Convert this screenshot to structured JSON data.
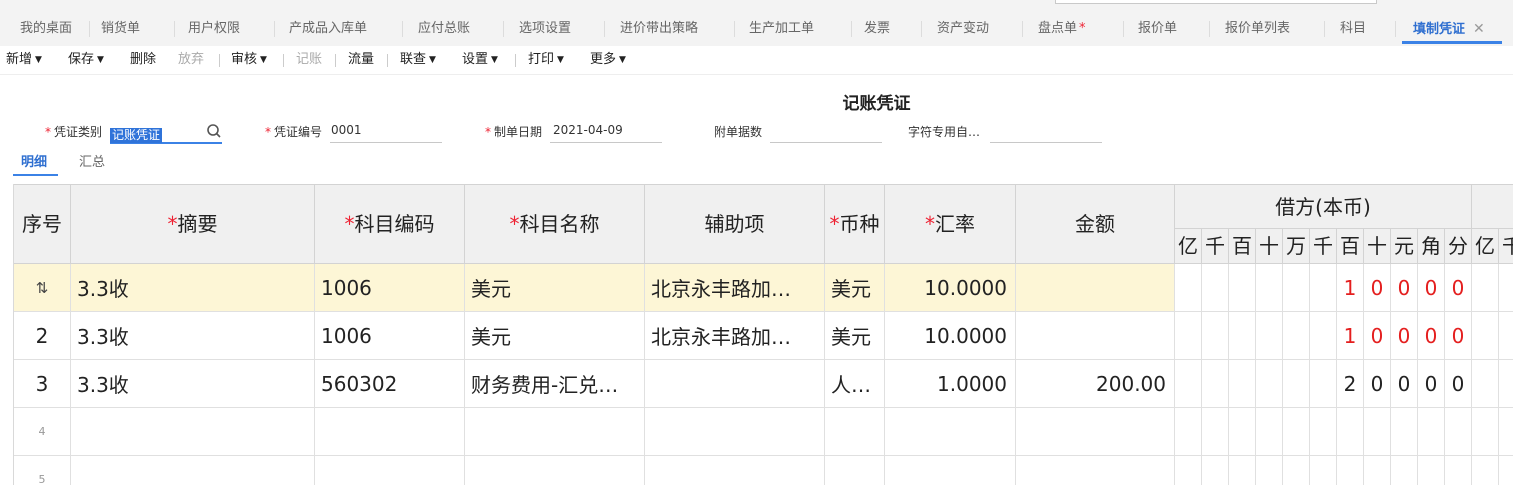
{
  "tabs": [
    {
      "label": "我的桌面"
    },
    {
      "label": "销货单"
    },
    {
      "label": "用户权限"
    },
    {
      "label": "产成品入库单"
    },
    {
      "label": "应付总账"
    },
    {
      "label": "选项设置"
    },
    {
      "label": "进价带出策略"
    },
    {
      "label": "生产加工单"
    },
    {
      "label": "发票"
    },
    {
      "label": "资产变动"
    },
    {
      "label": "盘点单",
      "star": "*"
    },
    {
      "label": "报价单"
    },
    {
      "label": "报价单列表"
    },
    {
      "label": "科目"
    },
    {
      "label": "填制凭证",
      "close": "✕"
    }
  ],
  "toolbar": {
    "add": "新增",
    "save": "保存",
    "delete": "删除",
    "discard": "放弃",
    "audit": "审核",
    "post": "记账",
    "flow": "流量",
    "lookup": "联查",
    "settings": "设置",
    "print": "打印",
    "more": "更多"
  },
  "voucher": {
    "title": "记账凭证",
    "type_label": "凭证类别",
    "type_value": "记账凭证",
    "no_label": "凭证编号",
    "no_value": "0001",
    "date_label": "制单日期",
    "date_value": "2021-04-09",
    "attach_label": "附单据数",
    "custom_label": "字符专用自…"
  },
  "subtabs": {
    "detail": "明细",
    "summary": "汇总"
  },
  "table": {
    "headers": {
      "seq": "序号",
      "summary": "摘要",
      "code": "科目编码",
      "name": "科目名称",
      "aux": "辅助项",
      "currency": "币种",
      "rate": "汇率",
      "amount": "金额",
      "debit": "借方(本币)"
    },
    "req_mark": "*",
    "digits": [
      "亿",
      "千",
      "百",
      "十",
      "万",
      "千",
      "百",
      "十",
      "元",
      "角",
      "分"
    ],
    "digits2": [
      "亿",
      "千"
    ],
    "rows": [
      {
        "seq": "⇅",
        "summary": "3.3收",
        "code": "1006",
        "name": "美元",
        "aux": "北京永丰路加…",
        "currency": "美元",
        "rate": "10.0000",
        "amount": "",
        "d": [
          "",
          "",
          "",
          "",
          "",
          "",
          "1",
          "0",
          "0",
          "0",
          "0"
        ]
      },
      {
        "seq": "2",
        "summary": "3.3收",
        "code": "1006",
        "name": "美元",
        "aux": "北京永丰路加…",
        "currency": "美元",
        "rate": "10.0000",
        "amount": "",
        "d": [
          "",
          "",
          "",
          "",
          "",
          "",
          "1",
          "0",
          "0",
          "0",
          "0"
        ]
      },
      {
        "seq": "3",
        "summary": "3.3收",
        "code": "560302",
        "name": "财务费用-汇兑…",
        "aux": "",
        "currency": "人…",
        "rate": "1.0000",
        "amount": "200.00",
        "d": [
          "",
          "",
          "",
          "",
          "",
          "",
          "2",
          "0",
          "0",
          "0",
          "0"
        ]
      },
      {
        "seq": "4",
        "summary": "",
        "code": "",
        "name": "",
        "aux": "",
        "currency": "",
        "rate": "",
        "amount": "",
        "d": [
          "",
          "",
          "",
          "",
          "",
          "",
          "",
          "",
          "",
          "",
          ""
        ]
      },
      {
        "seq": "5",
        "summary": "",
        "code": "",
        "name": "",
        "aux": "",
        "currency": "",
        "rate": "",
        "amount": "",
        "d": [
          "",
          "",
          "",
          "",
          "",
          "",
          "",
          "",
          "",
          "",
          ""
        ]
      }
    ]
  },
  "colors": {
    "accent": "#3b82e6",
    "required": "#e23",
    "debit_red": "#e41e1e",
    "selected_row": "#fdf6d6"
  }
}
